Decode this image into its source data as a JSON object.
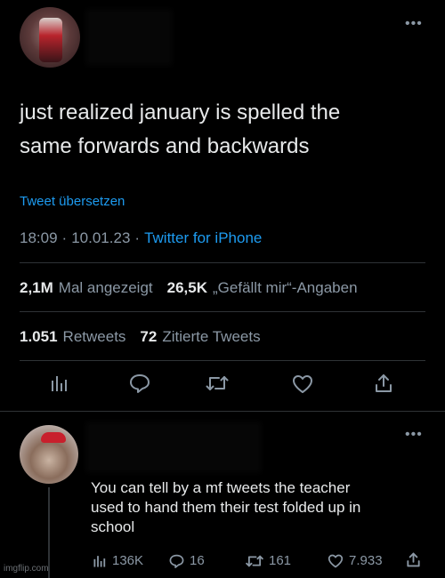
{
  "tweet": {
    "more_label": "•••",
    "text_line1": "just realized january is spelled the",
    "text_line2": "same forwards and backwards",
    "translate_label": "Tweet übersetzen",
    "time": "18:09",
    "dot1": "·",
    "date": "10.01.23",
    "dot2": "·",
    "client": "Twitter for iPhone",
    "views_count": "2,1M",
    "views_label": "Mal angezeigt",
    "likes_count": "26,5K",
    "likes_label": "„Gefällt mir“-Angaben",
    "retweets_count": "1.051",
    "retweets_label": "Retweets",
    "quotes_count": "72",
    "quotes_label": "Zitierte Tweets"
  },
  "reply": {
    "more_label": "•••",
    "text_line1": "You can tell by a mf tweets the teacher",
    "text_line2": "used to hand them their test folded up in",
    "text_line3": "school",
    "views": "136K",
    "replies": "16",
    "retweets": "161",
    "likes": "7.933"
  },
  "watermark": "imgflip.com",
  "icons": [
    "views-icon",
    "reply-icon",
    "retweet-icon",
    "like-icon",
    "share-icon"
  ],
  "colors": {
    "background": "#000000",
    "text": "#e7e9ea",
    "muted": "#8b98a5",
    "link": "#1d9bf0",
    "divider": "#2f3336"
  }
}
